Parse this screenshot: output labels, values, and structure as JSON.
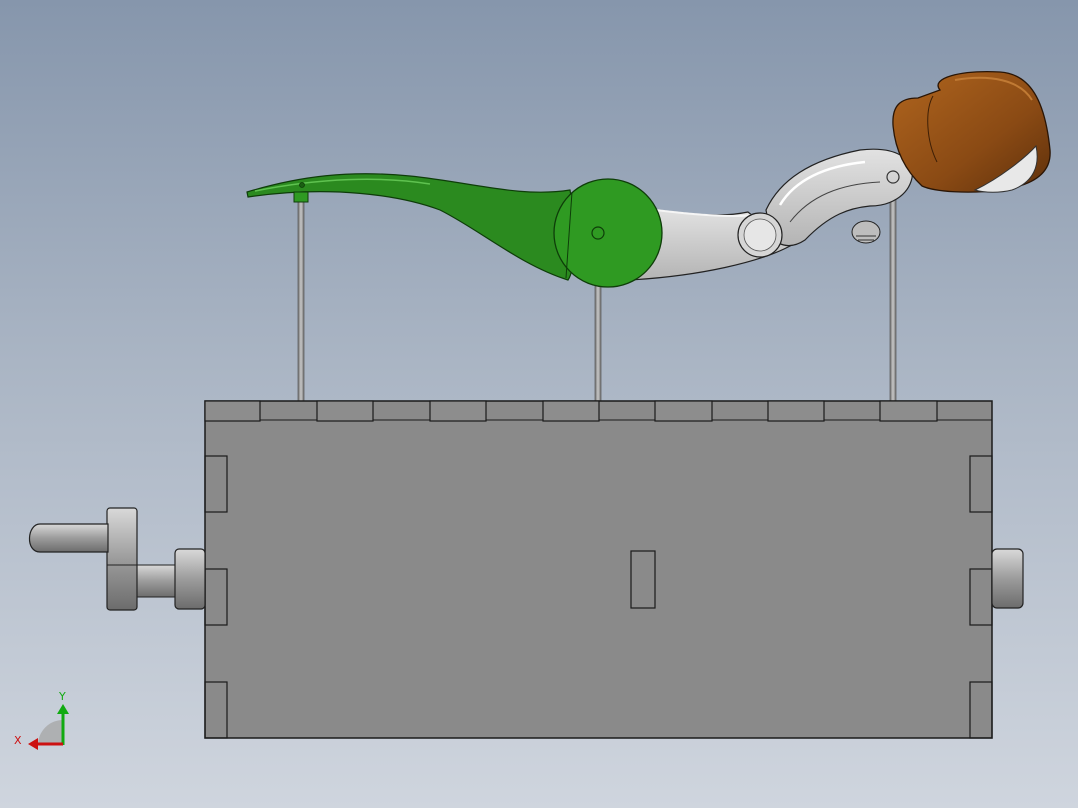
{
  "viewport": {
    "background_top": "#8696ac",
    "background_bottom": "#cfd5de"
  },
  "model": {
    "colors": {
      "box": "#8a8a8a",
      "box_edge": "#1a1a1a",
      "lever_arm": "#2b8a1f",
      "hinge_disc": "#2f9a22",
      "forearm": "#c9c9c9",
      "boxing_glove": "#8a4a14",
      "glove_cuff": "#e8e8e8",
      "crank": "#b5b5b5"
    },
    "parts": [
      "crank-handle",
      "crank-shaft",
      "cam-box",
      "push-rods",
      "green-lever-arm",
      "hinge-disc",
      "forearm-link",
      "elbow-joint",
      "boxing-glove"
    ]
  },
  "triad": {
    "x_label": "X",
    "y_label": "Y",
    "x_color": "#cc1111",
    "y_color": "#11aa11"
  }
}
